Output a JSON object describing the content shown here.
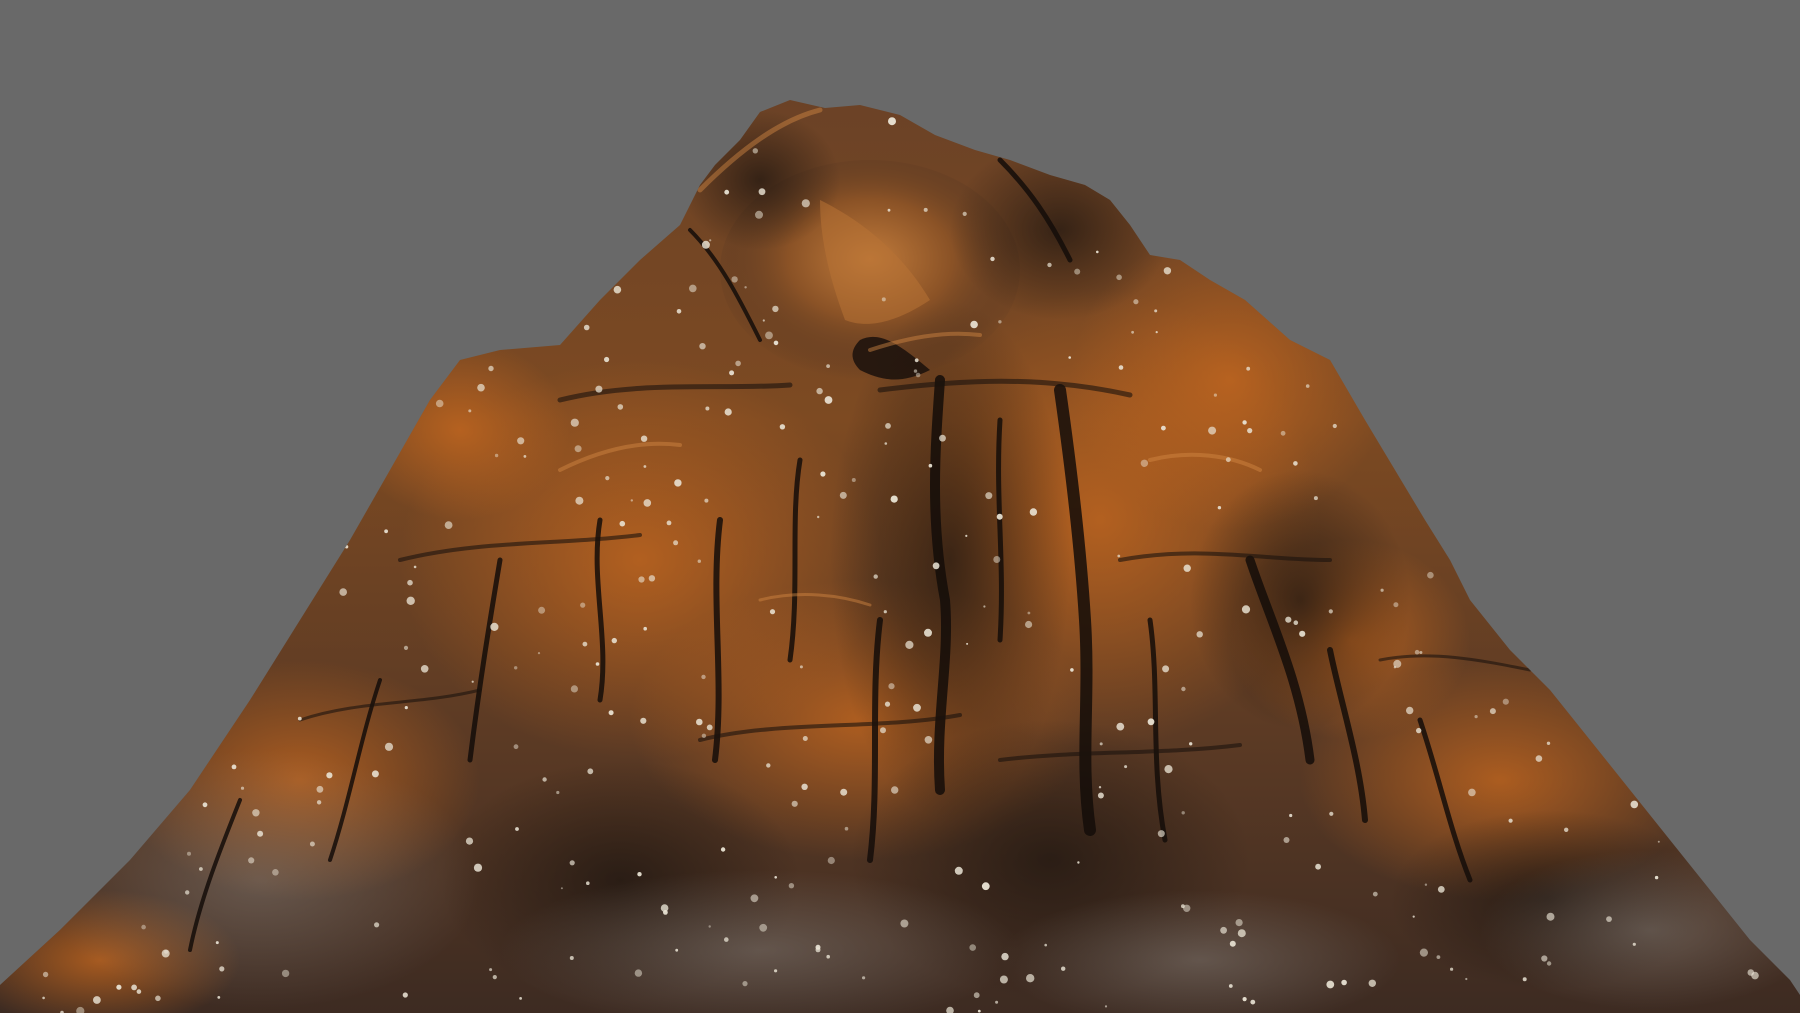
{
  "scene": {
    "subject": "rock-formation-render",
    "background_color": "#696969",
    "palette": {
      "rock_dark": "#2a1e17",
      "rock_mid": "#5a3a22",
      "rock_rust": "#9a5320",
      "rock_orange": "#c06a26",
      "rock_highlight": "#d58a3e",
      "lichen": "#e8e2d4",
      "crack": "#160f0b"
    }
  }
}
